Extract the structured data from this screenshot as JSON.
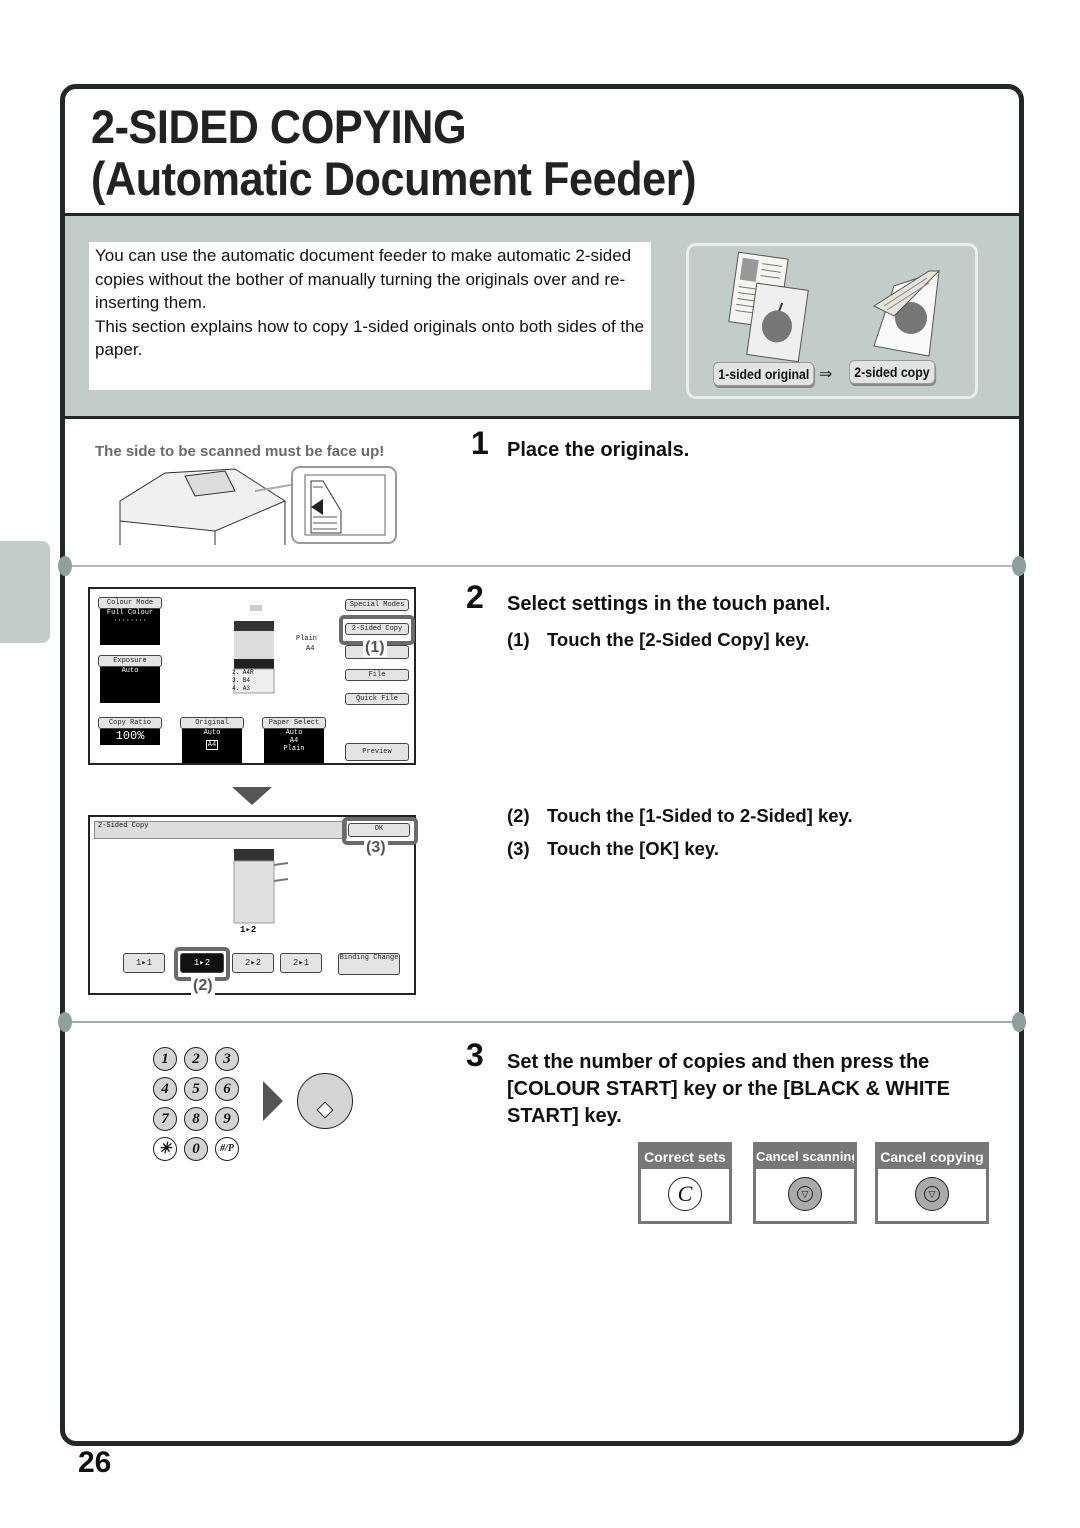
{
  "page": {
    "title_line1": "2-SIDED COPYING",
    "title_line2": "(Automatic Document Feeder)",
    "page_number": "26"
  },
  "intro": {
    "paragraph1": "You can use the automatic document feeder to make automatic 2-sided copies without the bother of manually turning the originals over and re-inserting them.",
    "paragraph2": "This section explains how to copy 1-sided originals onto both sides of the paper.",
    "illustration_from": "1-sided original",
    "illustration_to": "2-sided copy"
  },
  "steps": [
    {
      "number": "1",
      "title": "Place the originals.",
      "note": "The side to be scanned must be face up!"
    },
    {
      "number": "2",
      "title": "Select settings in the touch panel.",
      "substeps": [
        {
          "n": "(1)",
          "text": "Touch the [2-Sided Copy] key."
        },
        {
          "n": "(2)",
          "text": "Touch the [1-Sided to 2-Sided] key."
        },
        {
          "n": "(3)",
          "text": "Touch the [OK] key."
        }
      ]
    },
    {
      "number": "3",
      "title": "Set the number of copies and then press the [COLOUR START] key or the [BLACK & WHITE START] key."
    }
  ],
  "touch_panel_main": {
    "colour_mode_label": "Colour Mode",
    "colour_mode_value": "Full Colour",
    "exposure_label": "Exposure",
    "exposure_value": "Auto",
    "copy_ratio_label": "Copy Ratio",
    "copy_ratio_value": "100%",
    "original_label": "Original",
    "original_value": "Auto",
    "original_size": "A4",
    "paper_select_label": "Paper Select",
    "paper_select_value1": "Auto",
    "paper_select_value2": "A4",
    "paper_select_value3": "Plain",
    "paper_type": "Plain",
    "paper_size": "A4",
    "trays": [
      "2. A4R",
      "3. B4",
      "4. A3"
    ],
    "special_modes": "Special Modes",
    "two_sided_copy": "2-Sided Copy",
    "file": "File",
    "quick_file": "Quick File",
    "preview": "Preview",
    "callout": "(1)"
  },
  "touch_panel_2sided": {
    "header": "2-Sided Copy",
    "ok": "OK",
    "current_mode": "1▸2",
    "modes": [
      "1▸1",
      "1▸2",
      "2▸2",
      "2▸1"
    ],
    "binding_change": "Binding Change",
    "callout_ok": "(3)",
    "callout_mode": "(2)"
  },
  "keypad": {
    "keys": [
      "1",
      "2",
      "3",
      "4",
      "5",
      "6",
      "7",
      "8",
      "9",
      "✳",
      "0",
      "#/P"
    ]
  },
  "action_cards": [
    {
      "label": "Correct sets",
      "icon": "clear-key-icon",
      "glyph": "C"
    },
    {
      "label": "Cancel scanning",
      "icon": "stop-key-icon",
      "glyph": ""
    },
    {
      "label": "Cancel copying",
      "icon": "stop-key-icon",
      "glyph": ""
    }
  ]
}
